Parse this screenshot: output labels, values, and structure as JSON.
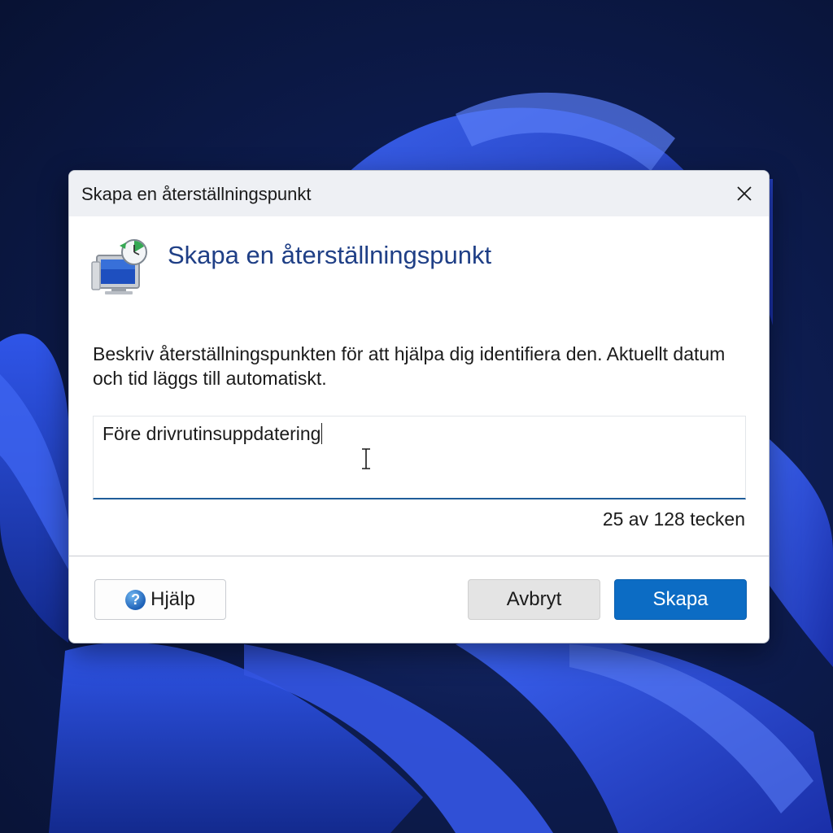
{
  "window": {
    "title": "Skapa en återställningspunkt",
    "close_icon": "close-icon"
  },
  "content": {
    "icon": "system-restore-icon",
    "heading": "Skapa en återställningspunkt",
    "description": "Beskriv återställningspunkten för att hjälpa dig identifiera den. Aktuellt datum och tid läggs till automatiskt.",
    "input": {
      "value": "Före drivrutinsuppdatering"
    },
    "char_count": "25 av 128 tecken"
  },
  "buttons": {
    "help_label": "Hjälp",
    "help_icon": "help-icon",
    "cancel_label": "Avbryt",
    "create_label": "Skapa"
  },
  "colors": {
    "accent": "#0c6cc4",
    "heading": "#1f3f86",
    "input_underline": "#1f5d9a"
  }
}
